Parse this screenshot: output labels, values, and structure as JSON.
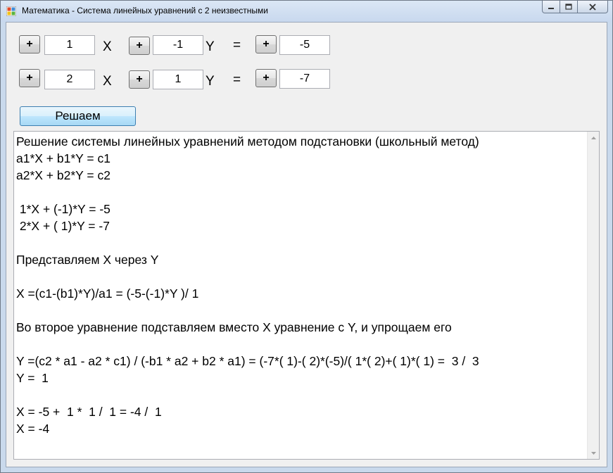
{
  "window": {
    "title": "Математика - Система линейных уравнений с 2 неизвестными"
  },
  "equations": [
    {
      "plus_label": "+",
      "a_value": "1",
      "x_label": "X",
      "b_value": "-1",
      "y_label": "Y",
      "eq_label": "=",
      "c_value": "-5"
    },
    {
      "plus_label": "+",
      "a_value": "2",
      "x_label": "X",
      "b_value": "1",
      "y_label": "Y",
      "eq_label": "=",
      "c_value": "-7"
    }
  ],
  "solve_button": {
    "label": "Решаем"
  },
  "output": {
    "lines": [
      "Решение системы линейных уравнений методом подстановки (школьный метод)",
      "a1*X + b1*Y = c1",
      "a2*X + b2*Y = c2",
      "",
      " 1*X + (-1)*Y = -5",
      " 2*X + ( 1)*Y = -7",
      "",
      "Представляем X через Y",
      "",
      "X =(c1-(b1)*Y)/a1 = (-5-(-1)*Y )/ 1",
      "",
      "Во второе уравнение подставляем вместо X уравнение с Y, и упрощаем его",
      "",
      "Y =(c2 * a1 - a2 * c1) / (-b1 * a2 + b2 * a1) = (-7*( 1)-( 2)*(-5)/( 1*( 2)+( 1)*( 1) =  3 /  3",
      "Y =  1",
      "",
      "X = -5 +  1 *  1 /  1 = -4 /  1",
      "X = -4"
    ]
  },
  "icons": {
    "app": "app-icon",
    "minimize": "minimize-icon",
    "maximize": "maximize-icon",
    "close": "close-icon"
  }
}
